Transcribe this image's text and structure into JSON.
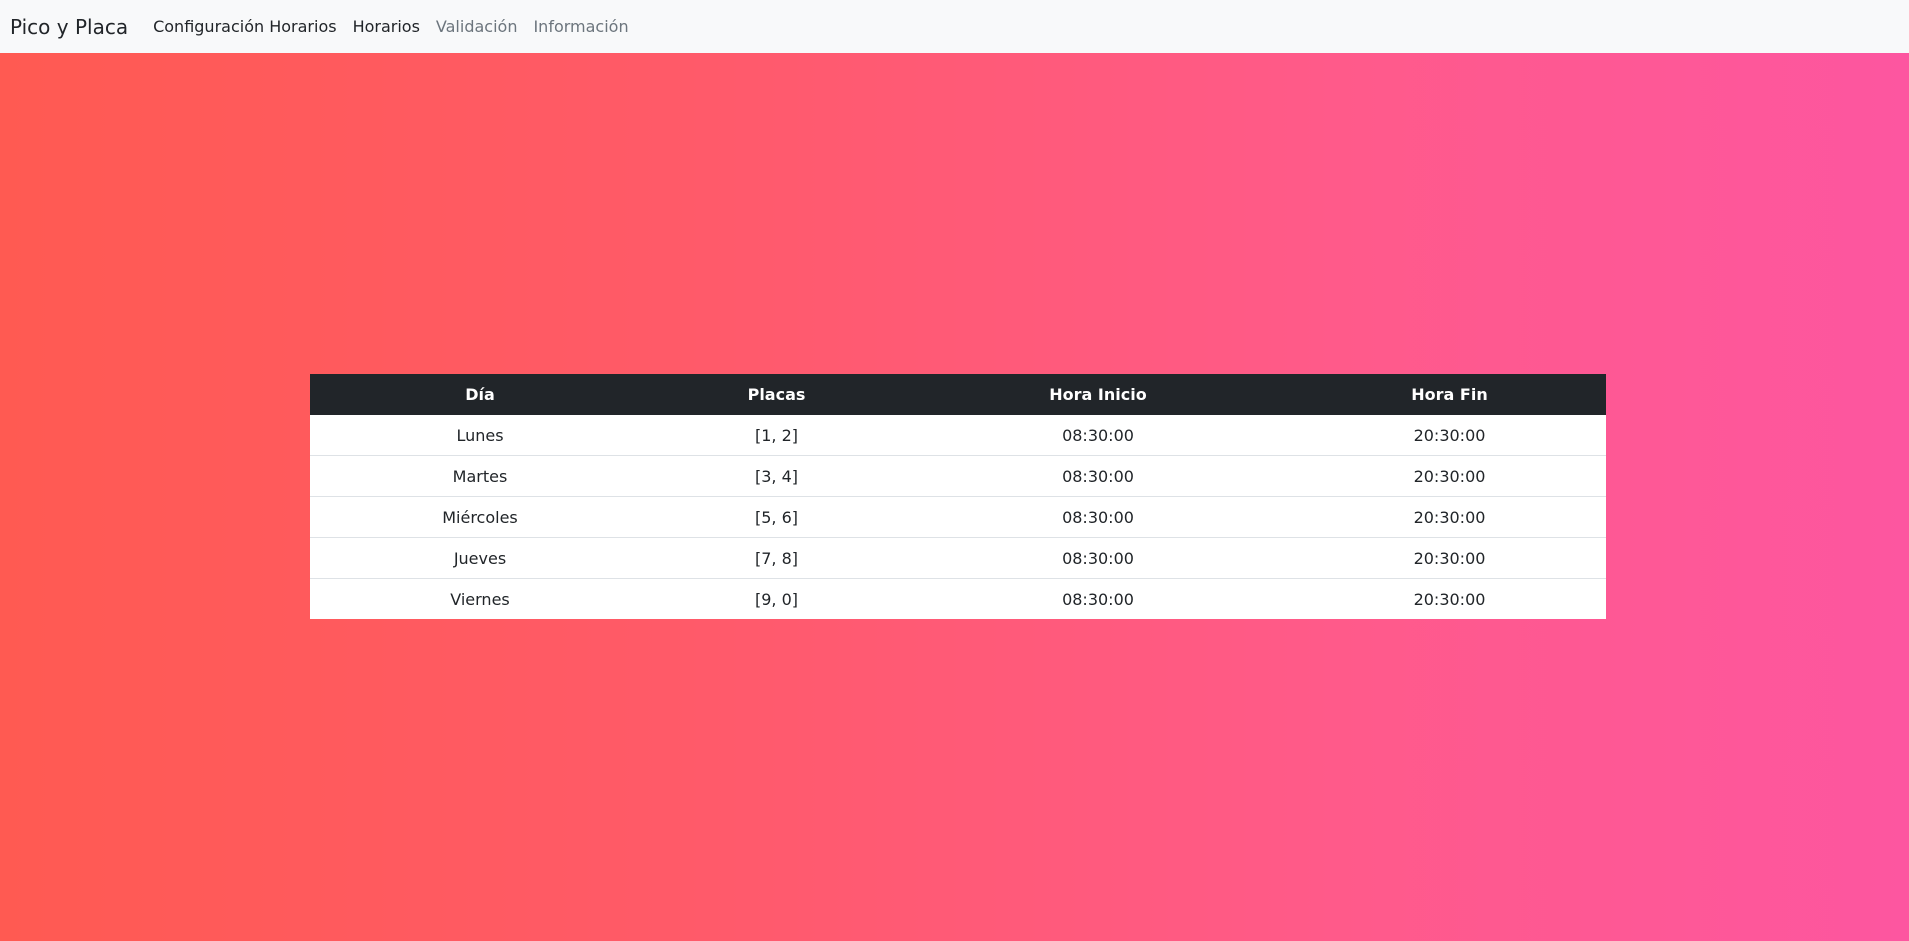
{
  "navbar": {
    "brand": "Pico y Placa",
    "links": [
      {
        "label": "Configuración Horarios"
      },
      {
        "label": "Horarios"
      },
      {
        "label": "Validación"
      },
      {
        "label": "Información"
      }
    ]
  },
  "table": {
    "headers": [
      "Día",
      "Placas",
      "Hora Inicio",
      "Hora Fin"
    ],
    "rows": [
      [
        "Lunes",
        "[1, 2]",
        "08:30:00",
        "20:30:00"
      ],
      [
        "Martes",
        "[3, 4]",
        "08:30:00",
        "20:30:00"
      ],
      [
        "Miércoles",
        "[5, 6]",
        "08:30:00",
        "20:30:00"
      ],
      [
        "Jueves",
        "[7, 8]",
        "08:30:00",
        "20:30:00"
      ],
      [
        "Viernes",
        "[9, 0]",
        "08:30:00",
        "20:30:00"
      ]
    ]
  },
  "colors": {
    "navbar_bg": "#f8f9fa",
    "table_header_bg": "#212529",
    "gradient_start": "#ff5a52",
    "gradient_end": "#fd56a0"
  }
}
